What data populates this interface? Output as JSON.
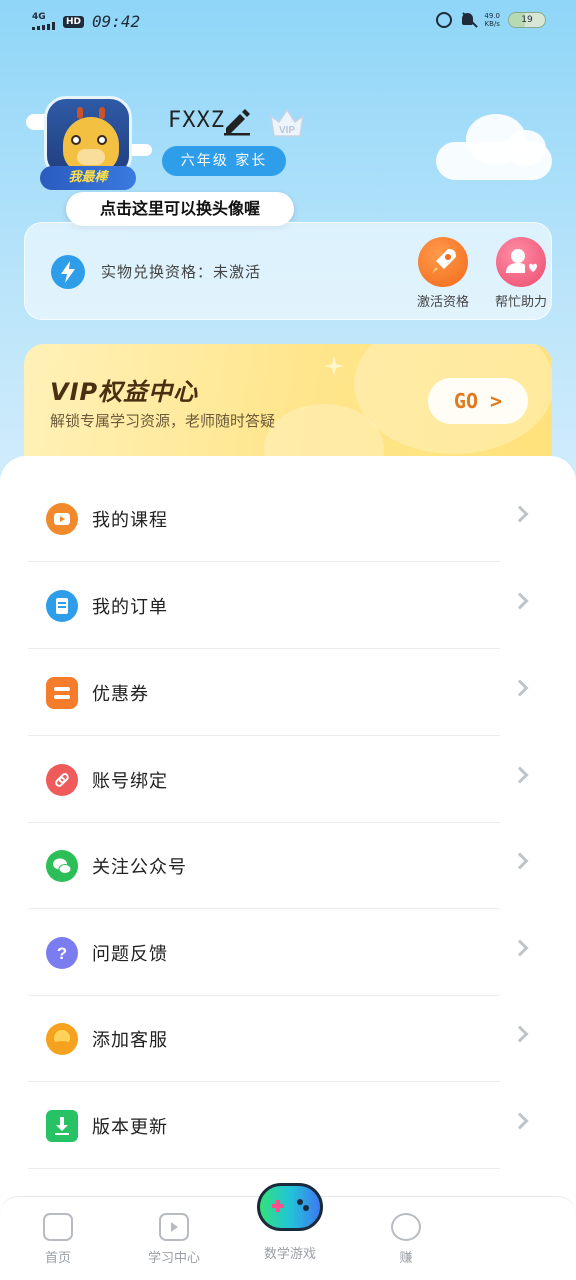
{
  "status_bar": {
    "network": "4G",
    "hd": "HD",
    "time": "09:42",
    "speed_value": "49.0",
    "speed_unit": "KB/s",
    "battery": "19"
  },
  "profile": {
    "avatar_banner": "我最棒",
    "username": "FXXZ",
    "vip_badge": "VIP",
    "grade": "六年级 家长",
    "avatar_tip": "点击这里可以换头像喔"
  },
  "redeem": {
    "status_text": "实物兑换资格：未激活",
    "actions": [
      {
        "label": "激活资格"
      },
      {
        "label": "帮忙助力"
      }
    ]
  },
  "vip_card": {
    "title": "VIP权益中心",
    "subtitle": "解锁专属学习资源，老师随时答疑",
    "go_label": "GO >"
  },
  "menu": {
    "items": [
      {
        "label": "我的课程",
        "color": "#f08a2c"
      },
      {
        "label": "我的订单",
        "color": "#2e9eea"
      },
      {
        "label": "优惠券",
        "color": "#f57c2a"
      },
      {
        "label": "账号绑定",
        "color": "#ef5a5a"
      },
      {
        "label": "关注公众号",
        "color": "#2dbf57"
      },
      {
        "label": "问题反馈",
        "color": "#7b7cf0"
      },
      {
        "label": "添加客服",
        "color": "#f7a21e"
      },
      {
        "label": "版本更新",
        "color": "#26c263"
      }
    ]
  },
  "bottom_nav": {
    "items": [
      {
        "label": "首页"
      },
      {
        "label": "学习中心"
      },
      {
        "label": "数学游戏"
      },
      {
        "label": "赚"
      }
    ]
  }
}
